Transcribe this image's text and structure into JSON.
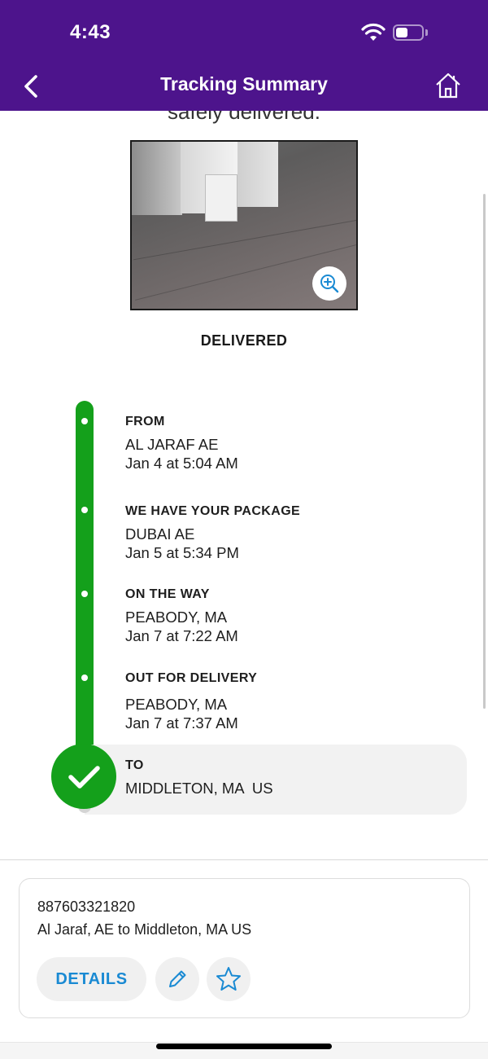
{
  "status_bar": {
    "time": "4:43"
  },
  "nav": {
    "title": "Tracking Summary"
  },
  "photo_section": {
    "caption_partial": "safely delivered.",
    "status": "DELIVERED"
  },
  "timeline": [
    {
      "title": "FROM",
      "location": "AL JARAF AE",
      "datetime": "Jan 4 at 5:04 AM"
    },
    {
      "title": "WE HAVE YOUR PACKAGE",
      "location": "DUBAI AE",
      "datetime": "Jan 5 at 5:34 PM"
    },
    {
      "title": "ON THE WAY",
      "location": "PEABODY, MA",
      "datetime": "Jan 7 at 7:22 AM"
    },
    {
      "title": "OUT FOR DELIVERY",
      "location": "PEABODY, MA",
      "datetime": "Jan 7 at 7:37 AM"
    },
    {
      "title": "TO",
      "location": "MIDDLETON, MA  US"
    }
  ],
  "shipment": {
    "tracking_number": "887603321820",
    "route": "Al Jaraf, AE to Middleton, MA US",
    "details_label": "DETAILS"
  },
  "colors": {
    "header": "#4d148c",
    "progress": "#14a01b",
    "link": "#1a8ad3"
  },
  "icons": [
    "back-chevron-icon",
    "home-icon",
    "wifi-icon",
    "battery-icon",
    "zoom-in-icon",
    "checkmark-icon",
    "pencil-icon",
    "star-icon"
  ]
}
